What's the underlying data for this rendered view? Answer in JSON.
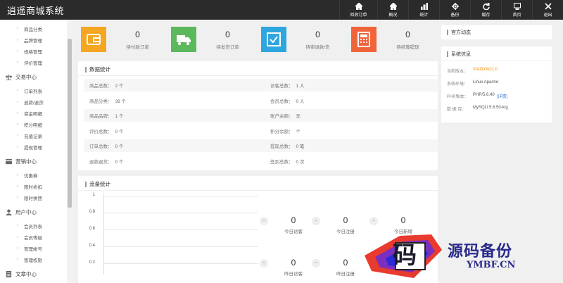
{
  "app": {
    "title": "逍遥商城系统"
  },
  "toolbar": [
    {
      "name": "toolbar-recycle-orders",
      "label": "回收订单",
      "icon": "home-icon"
    },
    {
      "name": "toolbar-overview",
      "label": "概况",
      "icon": "home-icon"
    },
    {
      "name": "toolbar-stats",
      "label": "统计",
      "icon": "bar-chart-icon"
    },
    {
      "name": "toolbar-backup",
      "label": "备份",
      "icon": "gear-icon"
    },
    {
      "name": "toolbar-cache",
      "label": "缓存",
      "icon": "refresh-icon"
    },
    {
      "name": "toolbar-home",
      "label": "首页",
      "icon": "monitor-icon"
    },
    {
      "name": "toolbar-logout",
      "label": "退出",
      "icon": "close-icon"
    }
  ],
  "sidebar": {
    "items": [
      {
        "type": "item",
        "label": "商品分类"
      },
      {
        "type": "item",
        "label": "品牌管理"
      },
      {
        "type": "item",
        "label": "规格管理"
      },
      {
        "type": "item",
        "label": "评价管理"
      },
      {
        "type": "group",
        "label": "交易中心",
        "icon": "scale-icon"
      },
      {
        "type": "item",
        "label": "订单列表"
      },
      {
        "type": "item",
        "label": "退款/退货"
      },
      {
        "type": "item",
        "label": "资金明细"
      },
      {
        "type": "item",
        "label": "积分明细"
      },
      {
        "type": "item",
        "label": "充值记录"
      },
      {
        "type": "item",
        "label": "提现管理"
      },
      {
        "type": "group",
        "label": "营销中心",
        "icon": "card-icon"
      },
      {
        "type": "item",
        "label": "优惠券"
      },
      {
        "type": "item",
        "label": "限时折扣"
      },
      {
        "type": "item",
        "label": "限时拼团"
      },
      {
        "type": "group",
        "label": "用户中心",
        "icon": "user-icon"
      },
      {
        "type": "item",
        "label": "会员列表"
      },
      {
        "type": "item",
        "label": "会员等级"
      },
      {
        "type": "item",
        "label": "管理帐号"
      },
      {
        "type": "item",
        "label": "管理权限"
      },
      {
        "type": "group",
        "label": "文章中心",
        "icon": "document-icon"
      }
    ]
  },
  "stats": [
    {
      "value": "0",
      "label": "待付款订单",
      "color": "#f5a623",
      "icon": "wallet-icon"
    },
    {
      "value": "0",
      "label": "待发货订单",
      "color": "#5cb85c",
      "icon": "truck-icon"
    },
    {
      "value": "0",
      "label": "待审退款/货",
      "color": "#2ea6df",
      "icon": "check-icon"
    },
    {
      "value": "0",
      "label": "待结算提现",
      "color": "#f0643c",
      "icon": "calculator-icon"
    }
  ],
  "data_panel": {
    "title": "数据统计",
    "rows": [
      {
        "left_key": "商品总数：",
        "left_val": "2 个",
        "right_key": "访客总数：",
        "right_val": "1 人"
      },
      {
        "left_key": "商品分类：",
        "left_val": "39 个",
        "right_key": "会员总数：",
        "right_val": "0 人"
      },
      {
        "left_key": "商品品牌：",
        "left_val": "1 个",
        "right_key": "账户余额：",
        "right_val": "元"
      },
      {
        "left_key": "评价总数：",
        "left_val": "0 个",
        "right_key": "积分余额：",
        "right_val": "个"
      },
      {
        "left_key": "订单总数：",
        "left_val": "0 个",
        "right_key": "提现总数：",
        "right_val": "0 笔"
      },
      {
        "left_key": "退款退货：",
        "left_val": "0 个",
        "right_key": "签到总数：",
        "right_val": "0 次"
      }
    ]
  },
  "flow_panel": {
    "title": "流量统计",
    "yticks": [
      "1",
      "0.8",
      "0.6",
      "0.4",
      "0.2"
    ],
    "items_top": [
      {
        "value": "0",
        "label": "今日访客"
      },
      {
        "value": "0",
        "label": "今日注册"
      },
      {
        "value": "0",
        "label": "今日新增"
      }
    ],
    "items_bottom": [
      {
        "value": "0",
        "label": "昨日访客"
      },
      {
        "value": "0",
        "label": "昨日注册"
      }
    ],
    "dot_glyph": "="
  },
  "right": {
    "news_title": "官方动态",
    "sys_title": "系统信息",
    "sys_rows": [
      {
        "key": "当前版本：",
        "val": "XIAOYAO1.0",
        "accent": true
      },
      {
        "key": "系统环境：",
        "val": "Linux Apache"
      },
      {
        "key": "PHP版本：",
        "val": "PHP/5.6.40",
        "link": "[详情]"
      },
      {
        "key": "数 据 库：",
        "val": "MySQLi 5.6.50-log"
      }
    ]
  },
  "watermark": {
    "line1": "源码备份",
    "line2": "YMBF.CN",
    "glyph": "码"
  }
}
